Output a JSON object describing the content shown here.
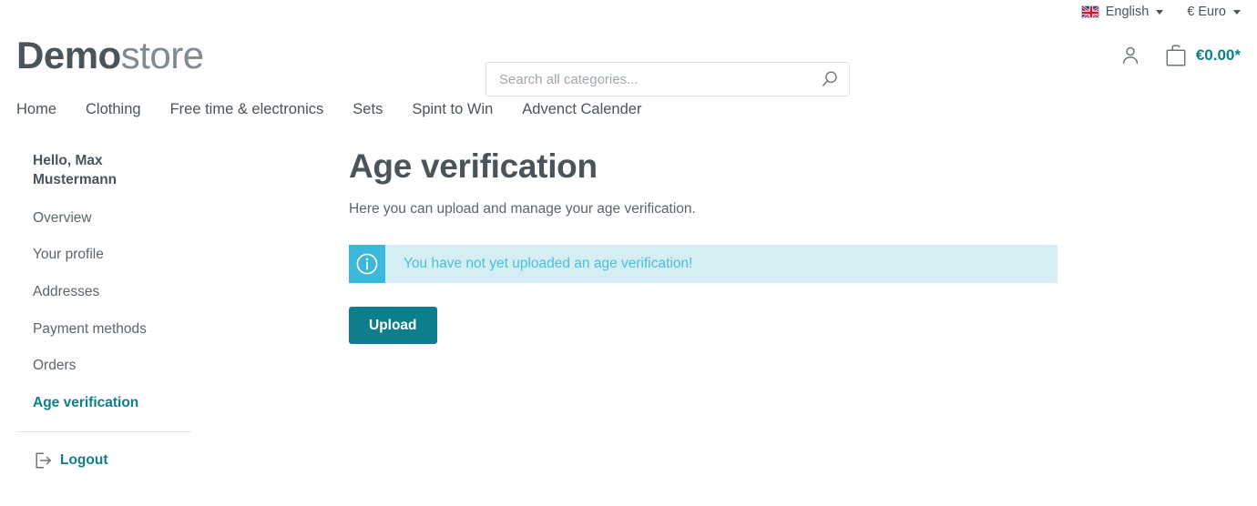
{
  "topbar": {
    "language": {
      "label": "English",
      "flag_icon": "uk-flag-icon"
    },
    "currency": {
      "label": "€ Euro"
    }
  },
  "header": {
    "logo": {
      "bold_part": "Demo",
      "light_part": "store"
    },
    "search": {
      "placeholder": "Search all categories...",
      "value": "",
      "icon": "search-icon"
    },
    "account_icon": "user-icon",
    "cart": {
      "icon": "shopping-bag-icon",
      "amount": "€0.00*"
    }
  },
  "nav": {
    "items": [
      {
        "label": "Home"
      },
      {
        "label": "Clothing"
      },
      {
        "label": "Free time & electronics"
      },
      {
        "label": "Sets"
      },
      {
        "label": "Spint to Win"
      },
      {
        "label": "Advenct Calender"
      }
    ]
  },
  "sidebar": {
    "greeting": "Hello, Max Mustermann",
    "items": [
      {
        "label": "Overview",
        "active": false
      },
      {
        "label": "Your profile",
        "active": false
      },
      {
        "label": "Addresses",
        "active": false
      },
      {
        "label": "Payment methods",
        "active": false
      },
      {
        "label": "Orders",
        "active": false
      },
      {
        "label": "Age verification",
        "active": true
      }
    ],
    "logout": {
      "label": "Logout",
      "icon": "logout-icon"
    }
  },
  "main": {
    "title": "Age verification",
    "subtitle": "Here you can upload and manage your age verification.",
    "alert": {
      "icon": "info-circle-icon",
      "message": "You have not yet uploaded an age verification!",
      "background_color": "#d4eef4",
      "icon_background_color": "#3cb8da",
      "text_color": "#49bfdc"
    },
    "upload_button": {
      "label": "Upload",
      "color": "#0d7f8c"
    }
  },
  "colors": {
    "accent_teal": "#0d7f8c",
    "text_primary": "#4a545b",
    "text_secondary": "#5b656c",
    "border": "#dfe3e6"
  }
}
